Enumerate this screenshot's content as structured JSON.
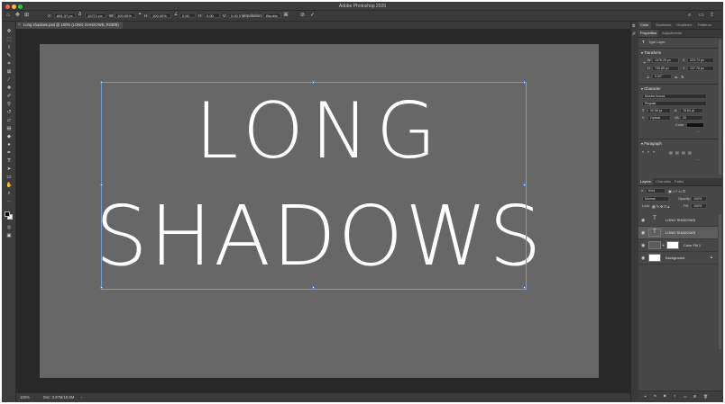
{
  "app": {
    "title": "Adobe Photoshop 2020"
  },
  "options_bar": {
    "x_label": "X:",
    "x_value": "681.37 px",
    "y_value": "10771 px",
    "w_label": "W:",
    "w_value": "100.00%",
    "h_label": "H:",
    "h_value": "100.00%",
    "angle_value": "0.00",
    "h_skew_label": "H:",
    "h_skew_value": "0.00",
    "v_skew_label": "V:",
    "v_skew_value": "0.00",
    "interpolation_label": "Interpolation:",
    "interpolation_value": "Bicubic"
  },
  "document": {
    "tab_label": "Long shadows.psd @ 100% (LONG SHADOWS, RGB/8)",
    "line1": "LONG",
    "line2": "SHADOWS"
  },
  "status": {
    "zoom": "100%",
    "doc_size": "Doc: 3.87M/10.8M"
  },
  "panels": {
    "top_tabs": [
      "Color",
      "Swatches",
      "Gradients",
      "Patterns"
    ],
    "prop_tabs": [
      "Properties",
      "Adjustments"
    ],
    "layer_type": "Type Layer",
    "transform": {
      "title": "Transform",
      "w": "1076.25 px",
      "x": "223.74 px",
      "h": "739.85 px",
      "y": "137.78 px",
      "angle": "0.00°"
    },
    "character": {
      "title": "Character",
      "font": "Mostra Nuova",
      "style": "Regular",
      "size": "92.58 pt",
      "leading": "78.84 pt",
      "kerning": "Optical",
      "tracking": "20",
      "color_label": "Color"
    },
    "paragraph": {
      "title": "Paragraph"
    },
    "layers_tabs": [
      "Layers",
      "Channels",
      "Paths"
    ],
    "layers": {
      "kind_label": "Kind",
      "blend_mode": "Normal",
      "opacity_label": "Opacity:",
      "opacity": "100%",
      "lock_label": "Lock:",
      "fill_label": "Fill:",
      "fill": "100%",
      "items": [
        {
          "name": "LONG SHADOWS"
        },
        {
          "name": "LONG SHADOWS"
        },
        {
          "name": "Color Fill 1"
        },
        {
          "name": "Background"
        }
      ]
    }
  }
}
